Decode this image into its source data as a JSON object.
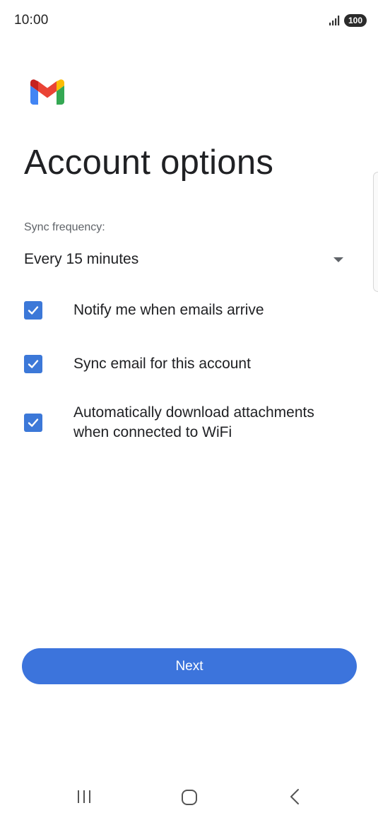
{
  "status_bar": {
    "time": "10:00",
    "battery": "100"
  },
  "logo": {
    "icon": "gmail-logo",
    "colors": [
      "#EA4335",
      "#4285F4",
      "#34A853",
      "#FBBC04",
      "#C5221F"
    ]
  },
  "page": {
    "title": "Account options"
  },
  "sync": {
    "label": "Sync frequency:",
    "value": "Every 15 minutes"
  },
  "options": [
    {
      "label": "Notify me when emails arrive",
      "checked": true
    },
    {
      "label": "Sync email for this account",
      "checked": true
    },
    {
      "label_line1": "Automatically download attachments",
      "label_line2": "when connected to WiFi",
      "checked": true
    }
  ],
  "buttons": {
    "next": "Next"
  },
  "nav": {
    "items": [
      "recent-apps-icon",
      "home-icon",
      "back-icon"
    ]
  },
  "colors": {
    "accent": "#3C74DC",
    "checkbox": "#3C78D8"
  }
}
